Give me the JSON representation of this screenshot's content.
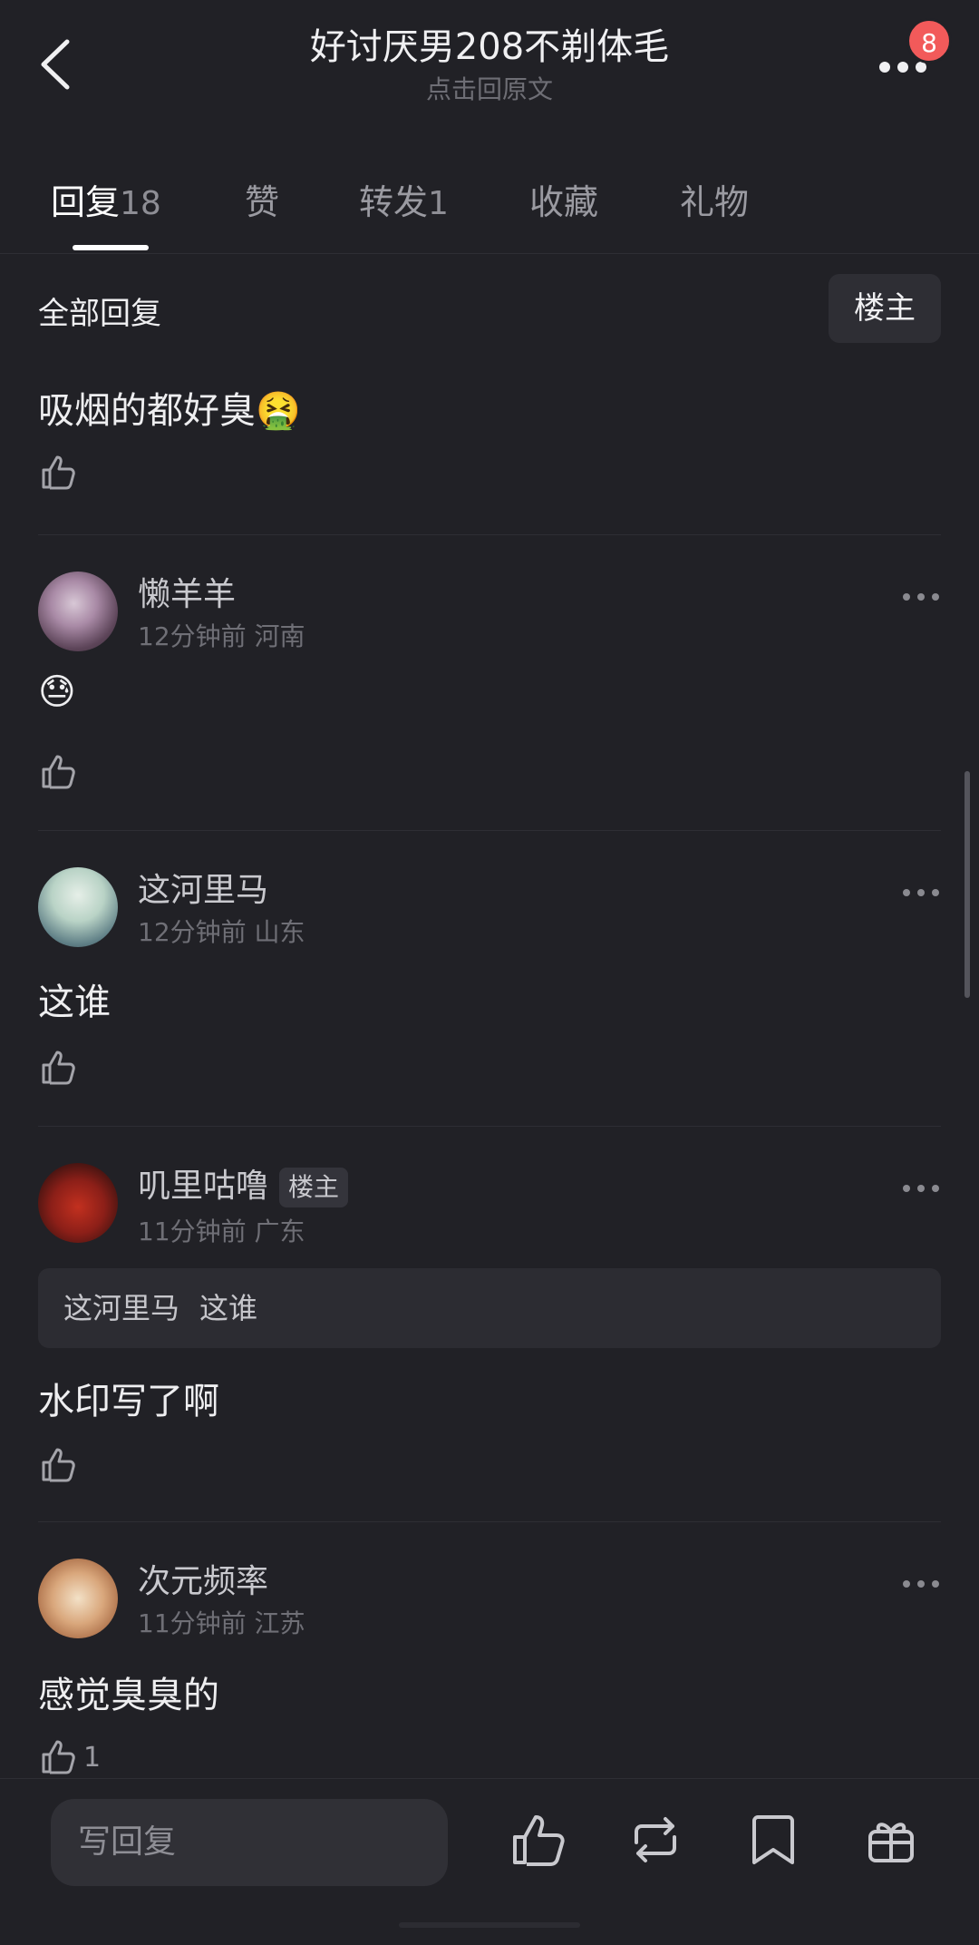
{
  "header": {
    "title": "好讨厌男208不剃体毛",
    "subtitle": "点击回原文",
    "notification_count": "8",
    "back_icon": "chevron-left-icon",
    "more_icon": "more-dots-icon"
  },
  "tabs": [
    {
      "label": "回复",
      "count": "18",
      "active": true
    },
    {
      "label": "赞",
      "count": "",
      "active": false
    },
    {
      "label": "转发",
      "count": "1",
      "active": false
    },
    {
      "label": "收藏",
      "count": "",
      "active": false
    },
    {
      "label": "礼物",
      "count": "",
      "active": false
    }
  ],
  "section": {
    "title": "全部回复",
    "filter_label": "楼主"
  },
  "posts": [
    {
      "content": "吸烟的都好臭🤮",
      "like_count": ""
    },
    {
      "username": "懒羊羊",
      "time": "12分钟前",
      "location": "河南",
      "content": "😓",
      "like_count": ""
    },
    {
      "username": "这河里马",
      "time": "12分钟前",
      "location": "山东",
      "content": "这谁",
      "like_count": ""
    },
    {
      "username": "叽里咕噜",
      "op_tag": "楼主",
      "time": "11分钟前",
      "location": "广东",
      "quote_user": "这河里马",
      "quote_text": "这谁",
      "content": "水印写了啊",
      "like_count": ""
    },
    {
      "username": "次元频率",
      "time": "11分钟前",
      "location": "江苏",
      "content": "感觉臭臭的",
      "like_count": "1"
    }
  ],
  "bottom_bar": {
    "reply_placeholder": "写回复",
    "icons": [
      "like-icon",
      "repost-icon",
      "bookmark-icon",
      "gift-icon"
    ]
  },
  "colors": {
    "background": "#212126",
    "text_primary": "#eeeef0",
    "text_secondary": "#6f6f76",
    "badge": "#f25a5a"
  }
}
